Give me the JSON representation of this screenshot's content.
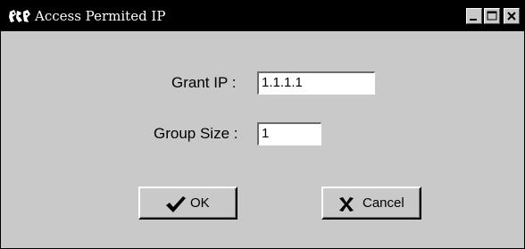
{
  "window": {
    "title": "Access Permited IP",
    "controls": {
      "minimize_icon": "minimize-icon",
      "maximize_icon": "maximize-icon",
      "close_icon": "close-icon"
    }
  },
  "form": {
    "grant_ip": {
      "label": "Grant IP :",
      "value": "1.1.1.1"
    },
    "group_size": {
      "label": "Group Size :",
      "value": "1"
    }
  },
  "buttons": {
    "ok_label": "OK",
    "cancel_label": "Cancel"
  },
  "colors": {
    "titlebar": "#000000",
    "dialog_background": "#c9c9c9",
    "field_background": "#ffffff"
  }
}
